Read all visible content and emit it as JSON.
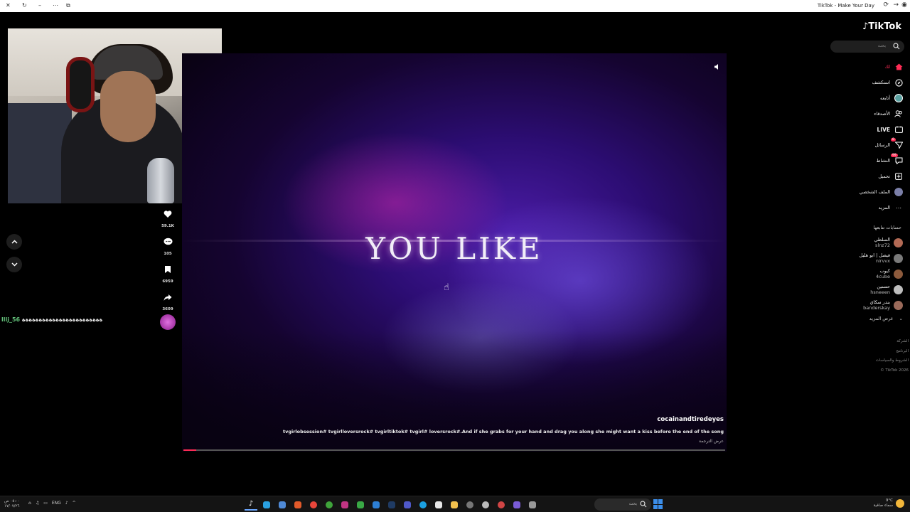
{
  "browser": {
    "window_title": "TikTok - Make Your Day"
  },
  "video": {
    "overlay_text": "YOU LIKE",
    "author": "cocainandtiredeyes",
    "description": "tvgirlobsession# tvgirlloversrock# tvgirltiktok# tvgirl# loversrock#.And if she grabs for your hand and drag you along she might want a kiss before the end of the song",
    "translate_label": "عرض الترجمة",
    "progress": 0.024
  },
  "actions": {
    "likes": "59.1K",
    "comments": "105",
    "saves": "6959",
    "shares": "3609"
  },
  "chat": {
    "user": "lllj_56",
    "message": "ةةةةةةةةةةةةةةةةةةةةةةةة"
  },
  "sidebar": {
    "logo": "TikTok",
    "search_placeholder": "بحث",
    "nav": [
      {
        "label": "لك",
        "icon": "home-icon",
        "active": true
      },
      {
        "label": "استكشف",
        "icon": "compass-icon"
      },
      {
        "label": "أتابعه",
        "icon": "following-avatar-icon"
      },
      {
        "label": "الأصدقاء",
        "icon": "friends-icon"
      },
      {
        "label": "LIVE",
        "icon": "live-icon"
      },
      {
        "label": "الرسائل",
        "icon": "messages-icon",
        "badge": "8"
      },
      {
        "label": "النشاط",
        "icon": "activity-icon",
        "badge": "99"
      },
      {
        "label": "تحميل",
        "icon": "upload-icon"
      },
      {
        "label": "الملف الشخصي",
        "icon": "profile-icon"
      },
      {
        "label": "المزيد",
        "icon": "more-icon"
      }
    ],
    "following_title": "حسابات تتابعها",
    "following": [
      {
        "name": "السلطي",
        "handle": "slnz72",
        "color": "#b36a55"
      },
      {
        "name": "فيصل | ابو هليل",
        "handle": "nirvvx",
        "color": "#7a7a7a"
      },
      {
        "name": "كيوب",
        "handle": "4cube",
        "color": "#8c5a3c"
      },
      {
        "name": "حسنين",
        "handle": "hsneeen",
        "color": "#bdbdbd"
      },
      {
        "name": "بندر سكاي",
        "handle": "banderskay",
        "color": "#9a6a5a"
      }
    ],
    "see_more": "عرض المزيد",
    "footer": [
      "الشركة",
      "البرنامج",
      "الشروط والسياسات",
      "© TikTok 2026"
    ]
  },
  "taskbar": {
    "time": "٠٥:٠٠ ص",
    "date": "١٧/٠٧/٢٦",
    "lang": "ENG",
    "search_placeholder": "بحث",
    "weather_temp": "9°C",
    "weather_desc": "سماء صافية"
  },
  "colors": {
    "accent": "#fe2c55",
    "chat_user": "#63c17a"
  }
}
